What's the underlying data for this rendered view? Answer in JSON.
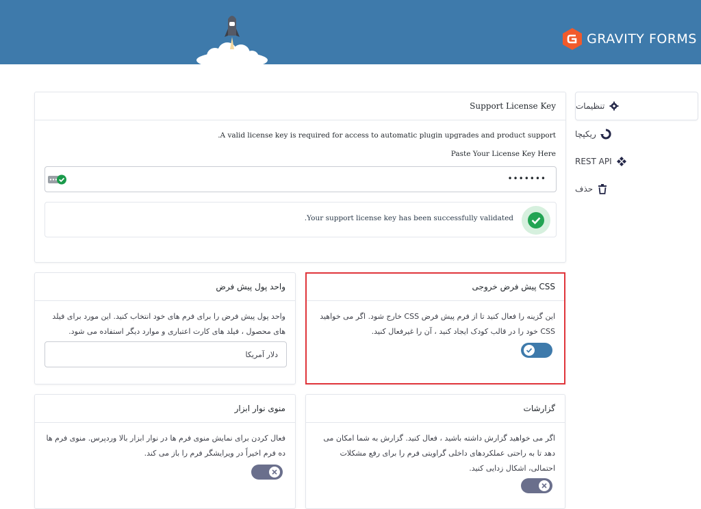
{
  "brand": {
    "name": "GRAVITY FORMS",
    "accent": "#f15a2b",
    "header_bg": "#3e7aab"
  },
  "sidebar": {
    "items": [
      {
        "label": "تنظیمات",
        "icon": "gear-icon"
      },
      {
        "label": "ریکپچا",
        "icon": "recaptcha-icon"
      },
      {
        "label": "REST API",
        "icon": "api-icon"
      },
      {
        "label": "حذف",
        "icon": "trash-icon"
      }
    ]
  },
  "license": {
    "title": "Support License Key",
    "requirement": "A valid license key is required for access to automatic plugin upgrades and product support.",
    "field_label": "Paste Your License Key Here",
    "field_value": "•••••••",
    "validated_message": "Your support license key has been successfully validated."
  },
  "currency": {
    "title": "واحد پول پیش فرض",
    "description": "واحد پول پیش فرض را برای فرم های خود انتخاب کنید. این مورد برای فیلد های محصول ، فیلد های کارت اعتباری و موارد دیگر استفاده می شود.",
    "selected": "دلار آمریکا"
  },
  "css_output": {
    "title": "CSS پیش فرض خروجی",
    "description": "این گزینه را فعال کنید تا از فرم پیش فرض CSS خارج شود. اگر می خواهید CSS خود را در قالب کودک ایجاد کنید ، آن را غیرفعال کنید.",
    "toggle_on": true
  },
  "toolbar_menu": {
    "title": "منوی نوار ابزار",
    "description": "فعال کردن برای نمایش منوی فرم ها در نوار ابزار بالا وردپرس. منوی فرم ها ده فرم اخیراً در ویرایشگر فرم را باز می کند.",
    "toggle_on": false
  },
  "logging": {
    "title": "گزارشات",
    "description": "اگر می خواهید گزارش داشته باشید ، فعال کنید. گزارش به شما امکان می دهد تا به راحتی عملکردهای داخلی گراویتی فرم را برای رفع مشکلات احتمالی، اشکال زدایی کنید.",
    "toggle_on": false
  }
}
